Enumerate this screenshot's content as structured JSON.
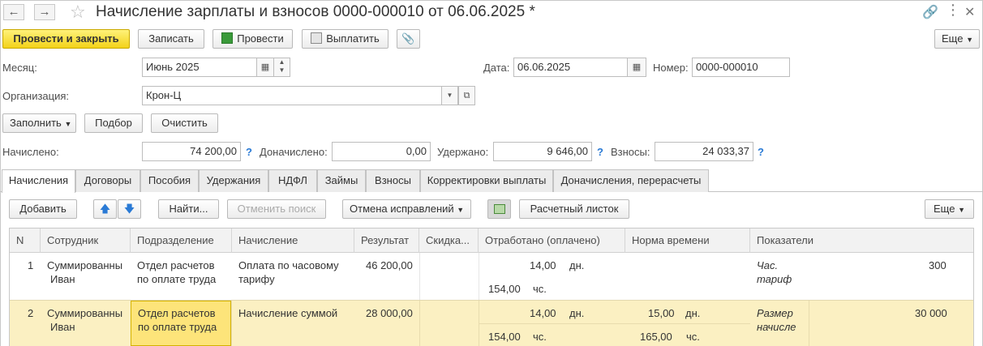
{
  "window": {
    "title": "Начисление зарплаты и взносов 0000-000010 от 06.06.2025 *",
    "icons": [
      "arrow-left-icon",
      "arrow-right-icon",
      "star-icon",
      "link-icon",
      "more-vertical-icon",
      "close-icon"
    ]
  },
  "toolbar": {
    "post_close": "Провести и закрыть",
    "save": "Записать",
    "post": "Провести",
    "pay": "Выплатить",
    "more": "Еще"
  },
  "form": {
    "month_label": "Месяц:",
    "month_value": "Июнь 2025",
    "date_label": "Дата:",
    "date_value": "06.06.2025",
    "number_label": "Номер:",
    "number_value": "0000-000010",
    "org_label": "Организация:",
    "org_value": "Крон-Ц",
    "fill": "Заполнить",
    "select": "Подбор",
    "clear": "Очистить",
    "accrued_label": "Начислено:",
    "accrued_value": "74 200,00",
    "extra_label": "Доначислено:",
    "extra_value": "0,00",
    "withheld_label": "Удержано:",
    "withheld_value": "9 646,00",
    "contrib_label": "Взносы:",
    "contrib_value": "24 033,37",
    "q": "?"
  },
  "tabs": [
    "Начисления",
    "Договоры",
    "Пособия",
    "Удержания",
    "НДФЛ",
    "Займы",
    "Взносы",
    "Корректировки выплаты",
    "Доначисления, перерасчеты"
  ],
  "table_toolbar": {
    "add": "Добавить",
    "find": "Найти...",
    "cancel_search": "Отменить поиск",
    "cancel_corr": "Отмена исправлений",
    "payslip": "Расчетный листок",
    "more": "Еще"
  },
  "table": {
    "columns": [
      "N",
      "Сотрудник",
      "Подразделение",
      "Начисление",
      "Результат",
      "Скидка...",
      "Отработано (оплачено)",
      "Норма времени",
      "Показатели"
    ],
    "rows": [
      {
        "n": "1",
        "emp1": "Суммированны",
        "emp2": "Иван",
        "dep1": "Отдел расчетов",
        "dep2": "по оплате труда",
        "acc1": "Оплата по часовому",
        "acc2": "тарифу",
        "result": "46 200,00",
        "worked_days": "14,00",
        "worked_days_unit": "дн.",
        "worked_hours": "154,00",
        "worked_hours_unit": "чс.",
        "ind1": "Час.",
        "ind2": "тариф",
        "ind_val": "300"
      },
      {
        "n": "2",
        "emp1": "Суммированны",
        "emp2": "Иван",
        "dep1": "Отдел расчетов",
        "dep2": "по оплате труда",
        "acc1": "Начисление суммой",
        "result": "28 000,00",
        "worked_days": "14,00",
        "worked_days_unit": "дн.",
        "worked_hours": "154,00",
        "worked_hours_unit": "чс.",
        "norm_days": "15,00",
        "norm_days_unit": "дн.",
        "norm_hours": "165,00",
        "norm_hours_unit": "чс.",
        "ind1": "Размер",
        "ind2": "начисле",
        "ind_val": "30 000"
      }
    ]
  }
}
